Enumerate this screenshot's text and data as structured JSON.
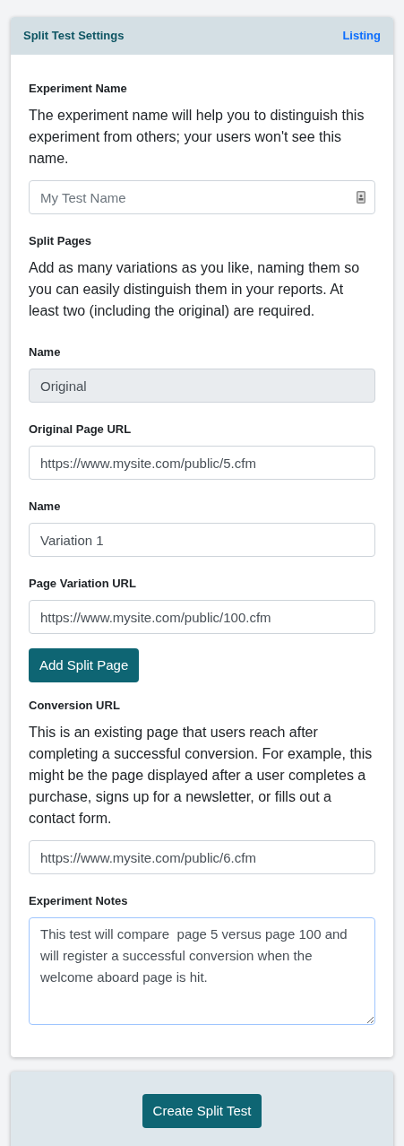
{
  "panel": {
    "title": "Split Test Settings",
    "link": "Listing"
  },
  "items": [
    {
      "kind": "label",
      "text": "Experiment Name"
    },
    {
      "kind": "help",
      "text": "The experiment name will help you to distinguish this experiment from others; your users won't see this name."
    },
    {
      "kind": "input",
      "placeholder": "My Test Name",
      "disabled": false,
      "focused": false,
      "contact_icon": true
    },
    {
      "kind": "label",
      "text": "Split Pages"
    },
    {
      "kind": "help",
      "text": "Add as many variations as you like, naming them so you can easily distinguish them in your reports. At least two (including the original) are required."
    },
    {
      "kind": "label",
      "text": "Name"
    },
    {
      "kind": "input",
      "value": "Original",
      "disabled": true,
      "focused": false,
      "contact_icon": false
    },
    {
      "kind": "label",
      "text": "Original Page URL"
    },
    {
      "kind": "input",
      "value": "https://www.mysite.com/public/5.cfm",
      "disabled": false,
      "focused": false,
      "contact_icon": false
    },
    {
      "kind": "label",
      "text": "Name"
    },
    {
      "kind": "input",
      "value": "Variation 1",
      "disabled": false,
      "focused": false,
      "contact_icon": false
    },
    {
      "kind": "label",
      "text": "Page Variation URL"
    },
    {
      "kind": "input",
      "value": "https://www.mysite.com/public/100.cfm",
      "disabled": false,
      "focused": false,
      "contact_icon": false
    },
    {
      "kind": "button",
      "text": "Add Split Page"
    },
    {
      "kind": "label",
      "text": "Conversion URL"
    },
    {
      "kind": "help",
      "text": "This is an existing page that users reach after completing a successful conversion. For example, this might be the page displayed after a user completes a purchase, signs up for a newsletter, or fills out a contact form."
    },
    {
      "kind": "input",
      "value": "https://www.mysite.com/public/6.cfm",
      "disabled": false,
      "focused": false,
      "contact_icon": false
    },
    {
      "kind": "label",
      "text": "Experiment Notes"
    },
    {
      "kind": "textarea",
      "value": "This test will compare  page 5 versus page 100 and will register a successful conversion when the welcome aboard page is hit.",
      "focused": true
    }
  ],
  "footer": {
    "button": "Create Split Test"
  }
}
